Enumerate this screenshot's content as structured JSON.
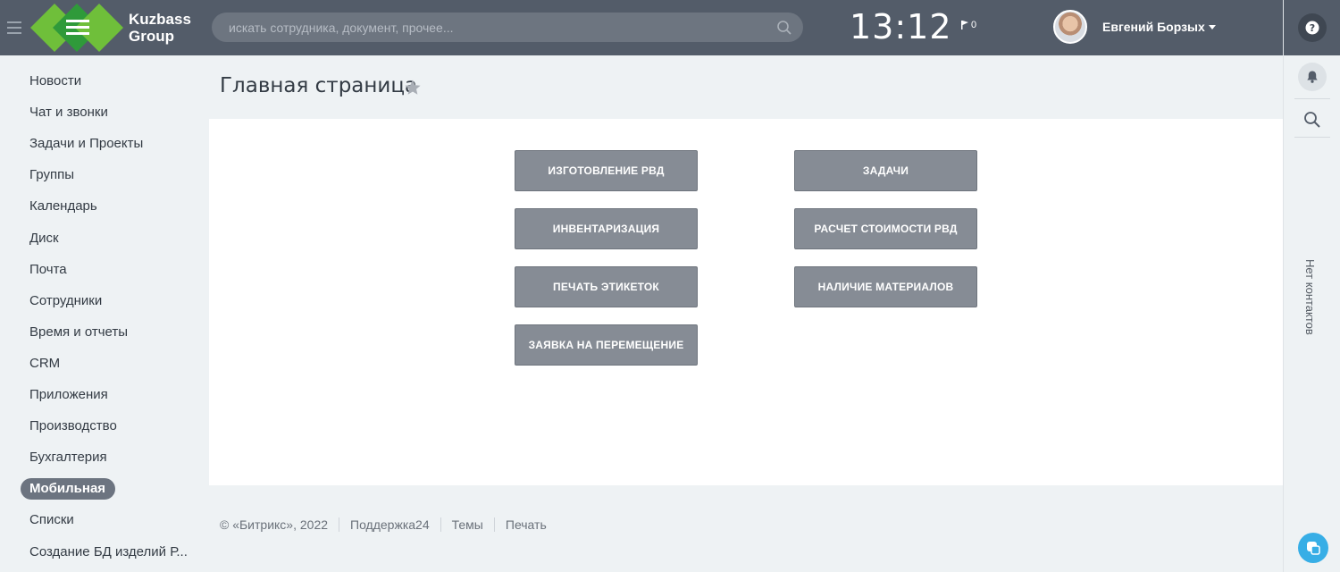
{
  "header": {
    "logo_text_line1": "Kuzbass",
    "logo_text_line2": "Group",
    "search_placeholder": "искать сотрудника, документ, прочее...",
    "clock": "13:12",
    "flag_count": "0",
    "user_name": "Евгений Борзых"
  },
  "menu": {
    "items": [
      "Новости",
      "Чат и звонки",
      "Задачи и Проекты",
      "Группы",
      "Календарь",
      "Диск",
      "Почта",
      "Сотрудники",
      "Время и отчеты",
      "CRM",
      "Приложения",
      "Производство",
      "Бухгалтерия",
      "Мобильная",
      "Списки",
      "Создание БД изделий Р..."
    ],
    "active_index": 13
  },
  "page": {
    "title": "Главная страница",
    "tiles": [
      "ИЗГОТОВЛЕНИЕ РВД",
      "ЗАДАЧИ",
      "ИНВЕНТАРИЗАЦИЯ",
      "РАСЧЕТ СТОИМОСТИ РВД",
      "ПЕЧАТЬ ЭТИКЕТОК",
      "НАЛИЧИЕ МАТЕРИАЛОВ",
      "ЗАЯВКА НА ПЕРЕМЕЩЕНИЕ"
    ]
  },
  "footer": {
    "copyright": "© «Битрикс», 2022",
    "support": "Поддержка24",
    "themes": "Темы",
    "print": "Печать"
  },
  "rightbar": {
    "no_contacts": "Нет контактов"
  },
  "colors": {
    "header_bg": "#535c69",
    "tile_bg": "#868c95",
    "active_menu_bg": "#6c7480",
    "chat_button": "#37aee6"
  }
}
